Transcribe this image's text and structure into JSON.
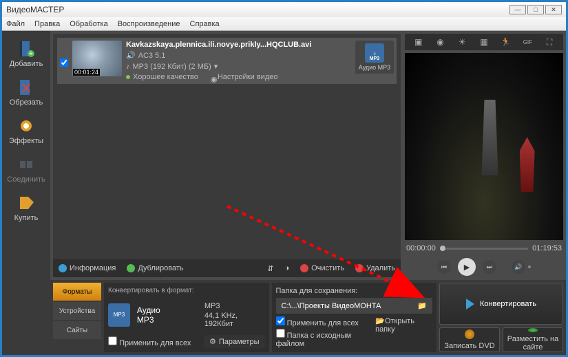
{
  "window": {
    "title": "ВидеоМАСТЕР"
  },
  "menu": {
    "file": "Файл",
    "edit": "Правка",
    "process": "Обработка",
    "play": "Воспроизведение",
    "help": "Справка"
  },
  "sidebar": {
    "items": [
      {
        "label": "Добавить"
      },
      {
        "label": "Обрезать"
      },
      {
        "label": "Эффекты"
      },
      {
        "label": "Соединить"
      },
      {
        "label": "Купить"
      }
    ]
  },
  "file": {
    "name": "Kavkazskaya.plennica.ili.novye.prikly...HQCLUB.avi",
    "audio": "AC3 5.1",
    "mp3": "MP3 (192 Кбит) (2 МБ)",
    "quality": "Хорошее качество",
    "settings": "Настройки видео",
    "timecode": "00:01:24",
    "format_label": "Аудио MP3"
  },
  "filetools": {
    "info": "Информация",
    "dup": "Дублировать",
    "clear": "Очистить",
    "del": "Удалить"
  },
  "timeline": {
    "start": "00:00:00",
    "end": "01:19:53"
  },
  "tabs": {
    "formats": "Форматы",
    "devices": "Устройства",
    "sites": "Сайты"
  },
  "fmtpanel": {
    "hdr": "Конвертировать в формат:",
    "name": "Аудио MP3",
    "detail1": "MP3",
    "detail2": "44,1 KHz, 192Кбит",
    "apply_all": "Применить для всех",
    "params": "Параметры"
  },
  "folderpanel": {
    "hdr": "Папка для сохранения:",
    "path": "C:\\...\\Проекты ВидеоМОНТА",
    "apply_all": "Применить для всех",
    "orig_folder": "Папка с исходным файлом",
    "open": "Открыть папку"
  },
  "actions": {
    "convert": "Конвертировать",
    "dvd": "Записать DVD",
    "upload": "Разместить на сайте"
  },
  "colors": {
    "good": "#8bc34a",
    "blue": "#3a9fd4",
    "orange": "#e0a030",
    "red": "#d44",
    "green": "#5b5"
  },
  "prevtools": [
    "crop-icon",
    "record-icon",
    "brightness-icon",
    "enhance-icon",
    "run-icon",
    "gif-icon",
    "fullscreen-icon"
  ]
}
